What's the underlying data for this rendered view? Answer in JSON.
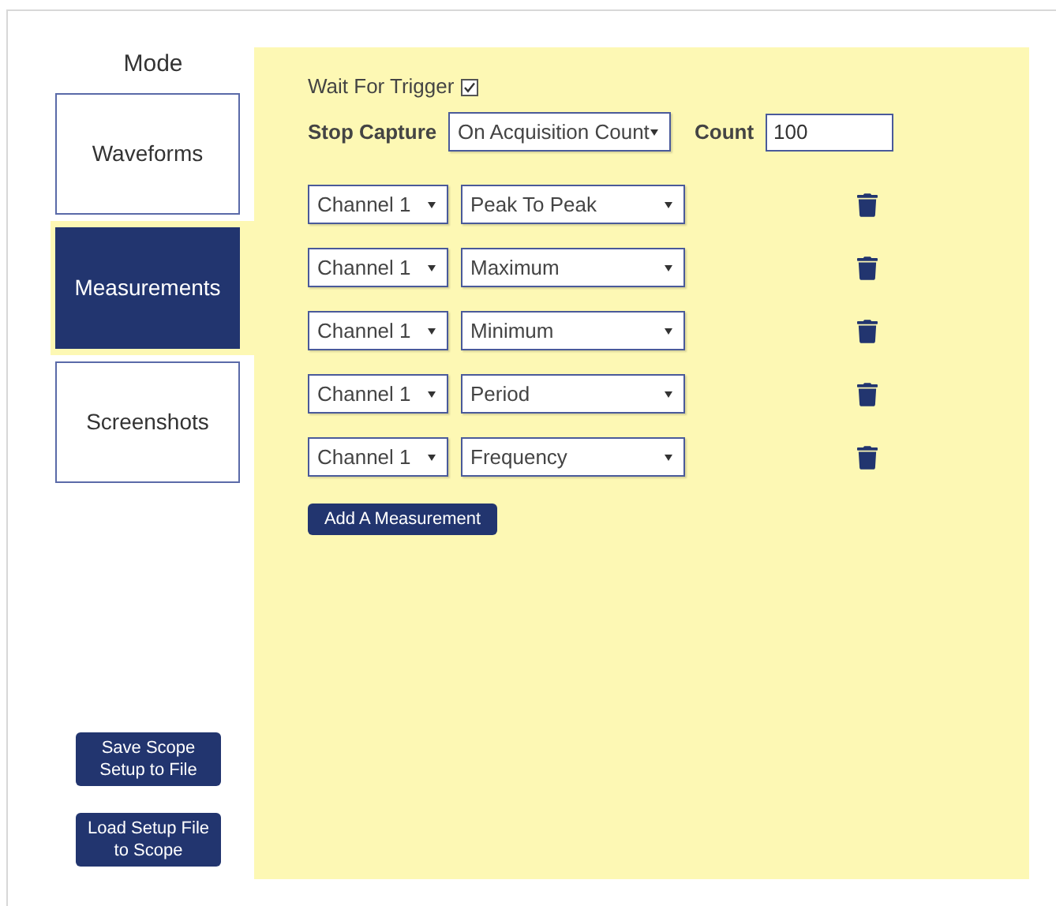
{
  "sidebar": {
    "title": "Mode",
    "tabs": [
      {
        "label": "Waveforms",
        "selected": false
      },
      {
        "label": "Measurements",
        "selected": true
      },
      {
        "label": "Screenshots",
        "selected": false
      }
    ],
    "buttons": [
      "Save Scope Setup to File",
      "Load Setup File to Scope"
    ]
  },
  "wait_for_trigger": {
    "label": "Wait For Trigger",
    "checked": true
  },
  "stop_capture": {
    "label": "Stop Capture",
    "value": "On Acquisition Count"
  },
  "count": {
    "label": "Count",
    "value": "100"
  },
  "measurements": [
    {
      "channel": "Channel 1",
      "type": "Peak To Peak"
    },
    {
      "channel": "Channel 1",
      "type": "Maximum"
    },
    {
      "channel": "Channel 1",
      "type": "Minimum"
    },
    {
      "channel": "Channel 1",
      "type": "Period"
    },
    {
      "channel": "Channel 1",
      "type": "Frequency"
    }
  ],
  "add_button": "Add A Measurement"
}
